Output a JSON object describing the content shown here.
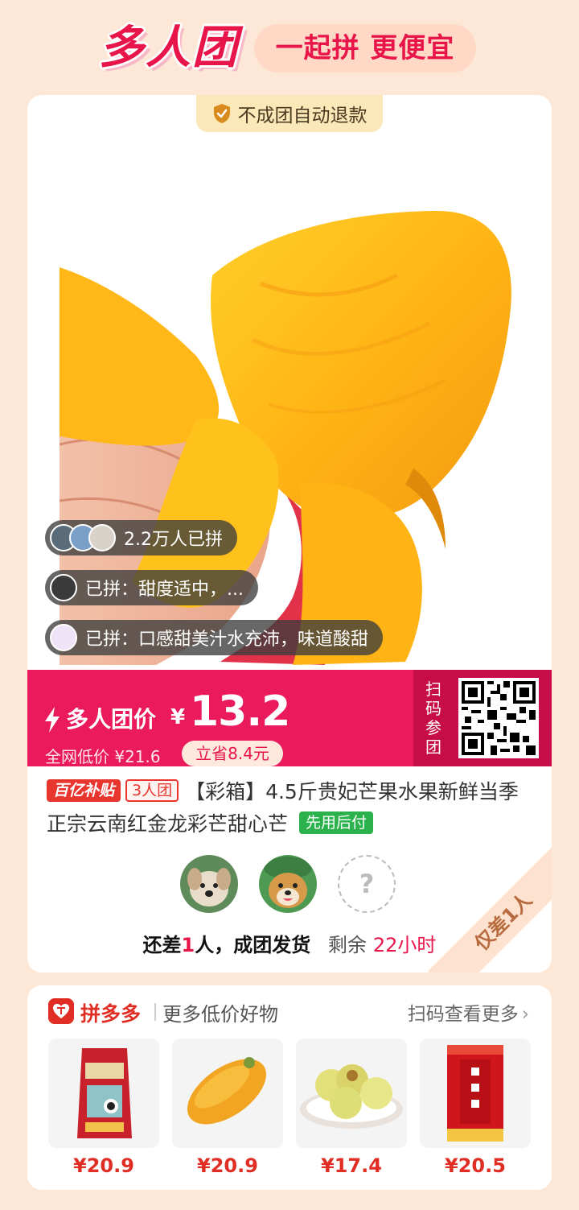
{
  "header": {
    "logo_text": "多人团",
    "slogan": "一起拼 更便宜"
  },
  "main": {
    "refund_badge": "不成团自动退款",
    "social": {
      "joined_count": "2.2万人已拼",
      "review1": "已拼：甜度适中，...",
      "review2": "已拼：口感甜美汁水充沛，味道酸甜"
    },
    "price": {
      "label": "多人团价",
      "currency": "¥",
      "value": "13.2",
      "lowest": "全网低价 ¥21.6",
      "save": "立省8.4元"
    },
    "scan_label": "扫码参团",
    "title": {
      "tag_subsidy": "百亿补贴",
      "tag_group": "3人团",
      "text": "【彩箱】4.5斤贵妃芒果水果新鲜当季正宗云南红金龙彩芒甜心芒",
      "tag_paylater": "先用后付"
    },
    "placeholder": "?",
    "status": {
      "need_prefix": "还差",
      "need_num": "1",
      "need_suffix": "人，成团发货",
      "remain_label": "剩余",
      "remain_time": "22小时"
    },
    "ribbon": "仅差1人"
  },
  "more": {
    "brand": "拼多多",
    "title": "更多低价好物",
    "scan_more": "扫码查看更多",
    "products": [
      {
        "price": "¥20.9"
      },
      {
        "price": "¥20.9"
      },
      {
        "price": "¥17.4"
      },
      {
        "price": "¥20.5"
      }
    ]
  },
  "colors": {
    "accent": "#ea1a5c",
    "background": "#fde7d6",
    "pdd_red": "#e02e24"
  },
  "icons": [
    "shield-check-icon",
    "bolt-icon",
    "chevron-right-icon",
    "pinduoduo-logo-icon"
  ]
}
